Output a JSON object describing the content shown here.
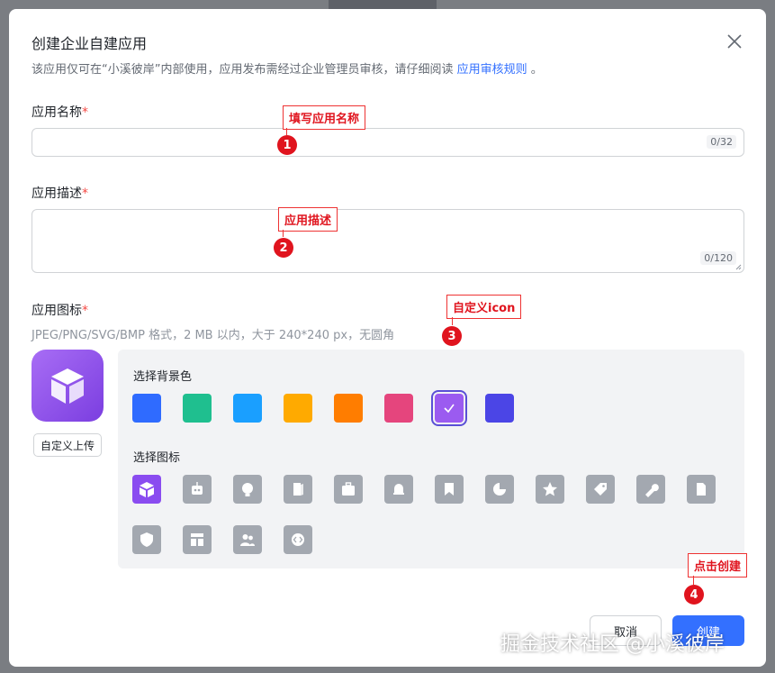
{
  "dialog": {
    "title": "创建企业自建应用",
    "subtitle_prefix": "该应用仅可在“小溪彼岸”内部使用，应用发布需经过企业管理员审核，请仔细阅读",
    "subtitle_link": "应用审核规则",
    "subtitle_suffix": "。"
  },
  "fields": {
    "name_label": "应用名称",
    "name_counter": "0/32",
    "desc_label": "应用描述",
    "desc_counter": "0/120",
    "icon_label": "应用图标",
    "required_mark": "*",
    "icon_hint": "JPEG/PNG/SVG/BMP 格式，2 MB 以内，大于 240*240 px，无圆角",
    "upload_label": "自定义上传"
  },
  "picker": {
    "bg_label": "选择背景色",
    "icon_label": "选择图标",
    "colors": [
      "#2f6bff",
      "#1fbf8f",
      "#1a9fff",
      "#ffaa00",
      "#ff7d00",
      "#e5457d",
      "#9b5bf0",
      "#4b45e6"
    ],
    "selected_color_index": 6,
    "icons": [
      "cube-icon",
      "robot-icon",
      "lightbulb-icon",
      "door-icon",
      "briefcase-icon",
      "bell-icon",
      "bookmark-icon",
      "pie-chart-icon",
      "star-icon",
      "tag-icon",
      "wrench-icon",
      "document-icon",
      "shield-icon",
      "layout-icon",
      "users-icon",
      "code-icon"
    ],
    "selected_icon_index": 0
  },
  "buttons": {
    "cancel": "取消",
    "create": "创建"
  },
  "annotations": {
    "a1": "填写应用名称",
    "a2": "应用描述",
    "a3": "自定义icon",
    "a4": "点击创建",
    "n1": "1",
    "n2": "2",
    "n3": "3",
    "n4": "4"
  },
  "watermark": "掘金技术社区 @小溪彼岸"
}
